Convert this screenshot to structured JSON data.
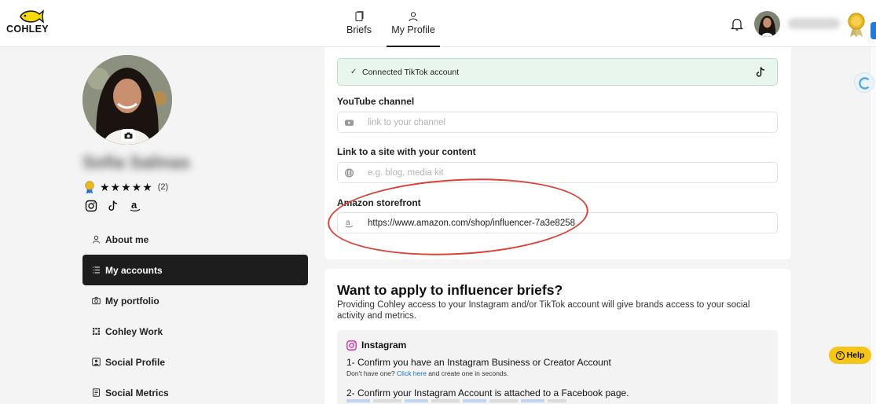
{
  "brand": {
    "logo_text": "COHLEY"
  },
  "nav": {
    "briefs_label": "Briefs",
    "profile_label": "My Profile"
  },
  "colors": {
    "accent_dark": "#1d1d1d",
    "success_bg": "#e8f6ee",
    "highlight_circle": "#d9443a",
    "help_yellow": "#f5c518",
    "link_blue": "#1f6fd1"
  },
  "profile": {
    "name": "Sofia Salinas",
    "stars": "★★★★★",
    "rating_count": "(2)"
  },
  "sidebar": {
    "items": [
      {
        "label": "About me",
        "icon": "person-icon"
      },
      {
        "label": "My accounts",
        "icon": "list-icon"
      },
      {
        "label": "My portfolio",
        "icon": "camera-icon"
      },
      {
        "label": "Cohley Work",
        "icon": "grid-icon"
      },
      {
        "label": "Social Profile",
        "icon": "user-square-icon"
      },
      {
        "label": "Social Metrics",
        "icon": "document-icon"
      }
    ]
  },
  "accounts": {
    "tiktok_status": "Connected TikTok account",
    "youtube_label": "YouTube channel",
    "youtube_placeholder": "link to your channel",
    "site_label": "Link to a site with your content",
    "site_placeholder": "e.g. blog, media kit",
    "amazon_label": "Amazon storefront",
    "amazon_value": "https://www.amazon.com/shop/influencer-7a3e8258"
  },
  "apply": {
    "title": "Want to apply to influencer briefs?",
    "description": "Providing Cohley access to your Instagram and/or TikTok account will give brands access to your social activity and metrics.",
    "instagram_title": "Instagram",
    "step1": "1- Confirm you have an Instagram Business or Creator Account",
    "step1_sub_prefix": "Don't have one?",
    "step1_sub_link": "Click here",
    "step1_sub_suffix": "and create one in seconds.",
    "step2": "2- Confirm your Instagram Account is attached to a Facebook page."
  },
  "help": {
    "label": "Help"
  }
}
